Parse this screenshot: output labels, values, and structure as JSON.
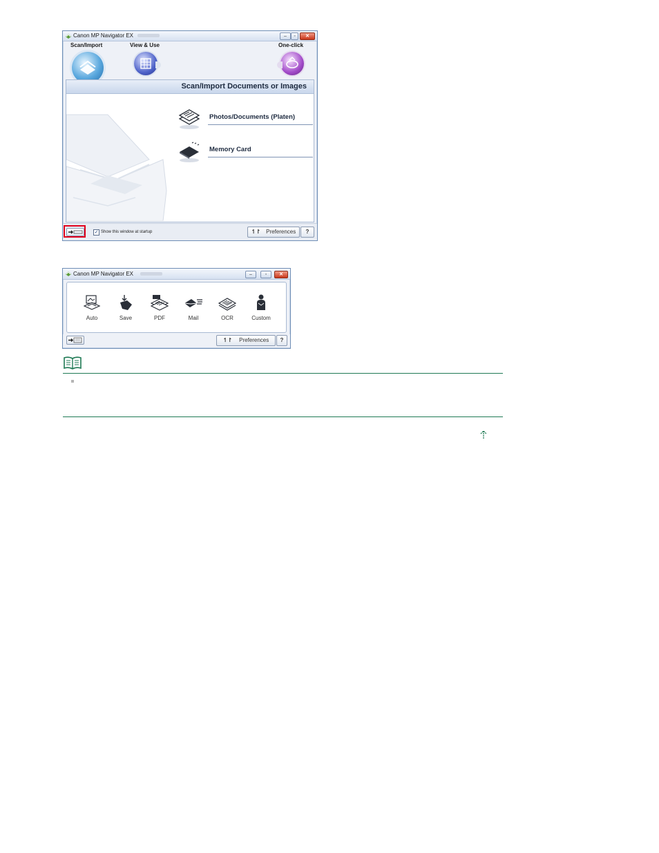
{
  "window_main": {
    "title": "Canon MP Navigator EX",
    "tabs": [
      {
        "label": "Scan/Import"
      },
      {
        "label": "View & Use"
      },
      {
        "label": "One-click"
      }
    ],
    "panel_title": "Scan/Import Documents or Images",
    "menu_items": [
      {
        "label": "Photos/Documents (Platen)"
      },
      {
        "label": "Memory Card"
      }
    ],
    "show_at_startup_label": "Show this window at startup",
    "show_at_startup_checked": true,
    "preferences_label": "Preferences",
    "help_label": "?",
    "highlight_color": "#e0001b"
  },
  "window_compact": {
    "title": "Canon MP Navigator EX",
    "tools": [
      {
        "label": "Auto",
        "icon": "auto-scan-icon"
      },
      {
        "label": "Save",
        "icon": "save-icon"
      },
      {
        "label": "PDF",
        "icon": "pdf-icon"
      },
      {
        "label": "Mail",
        "icon": "mail-icon"
      },
      {
        "label": "OCR",
        "icon": "ocr-icon"
      },
      {
        "label": "Custom",
        "icon": "custom-icon"
      }
    ],
    "preferences_label": "Preferences",
    "help_label": "?"
  },
  "colors": {
    "note_rule": "#1f7a54",
    "page_top_link": "#1f7a54"
  }
}
